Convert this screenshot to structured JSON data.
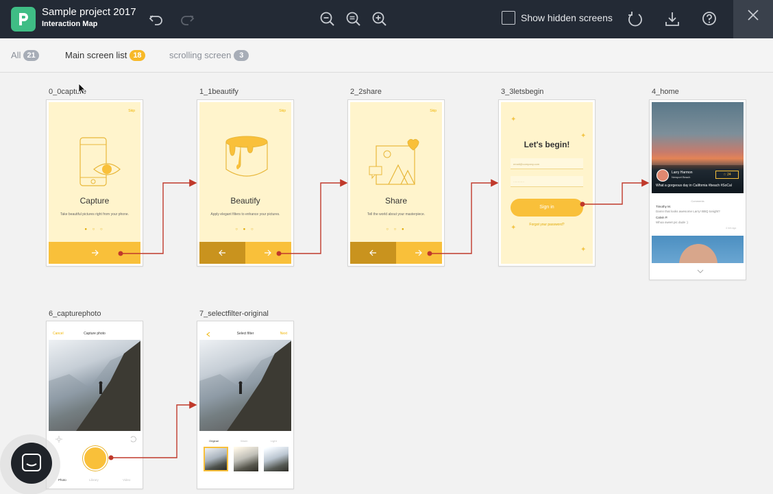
{
  "app": {
    "project_title": "Sample project 2017",
    "view_title": "Interaction Map",
    "logo_letter": "P",
    "accent": "#3fbd85",
    "connector_color": "#c0392b"
  },
  "toolbar": {
    "show_hidden_label": "Show hidden screens",
    "show_hidden_checked": false
  },
  "filters": [
    {
      "label": "All",
      "count": "21"
    },
    {
      "label": "Main screen list",
      "count": "18"
    },
    {
      "label": "scrolling screen",
      "count": "3"
    }
  ],
  "screens": [
    {
      "name": "0_0capture",
      "skip": "Skip",
      "title": "Capture",
      "desc": "Take beautiful pictures right from your phone."
    },
    {
      "name": "1_1beautify",
      "skip": "Skip",
      "title": "Beautify",
      "desc": "Apply elegant filters to enhance your pictures."
    },
    {
      "name": "2_2share",
      "skip": "Skip",
      "title": "Share",
      "desc": "Tell the world about your masterpiece."
    },
    {
      "name": "3_3letsbegin",
      "title": "Let's begin!",
      "email_placeholder": "email@company.com",
      "password_placeholder": "············",
      "signin": "Sign in",
      "forgot": "Forgot your password?"
    },
    {
      "name": "4_home",
      "user_name": "Larry Harmon",
      "location": "Newport Beach",
      "star_count": "24",
      "caption": "What a gorgeous day in California #beach #SoCal",
      "comments_label": "Comments",
      "comments": [
        {
          "name": "Timothy M.",
          "text": "Damn that looks awesome Larry! BBQ tonight?"
        },
        {
          "name": "Calvin P.",
          "text": "Whoa sweet pic dude :)"
        }
      ],
      "time": "4 min ago"
    },
    {
      "name": "6_capturephoto",
      "cancel": "Cancel",
      "title": "Capture photo",
      "tabs": [
        "Photo",
        "Library",
        "Video"
      ]
    },
    {
      "name": "7_selectfilter-original",
      "title": "Select filter",
      "next": "Next",
      "filters": [
        "Original",
        "Warm",
        "Light"
      ]
    }
  ]
}
